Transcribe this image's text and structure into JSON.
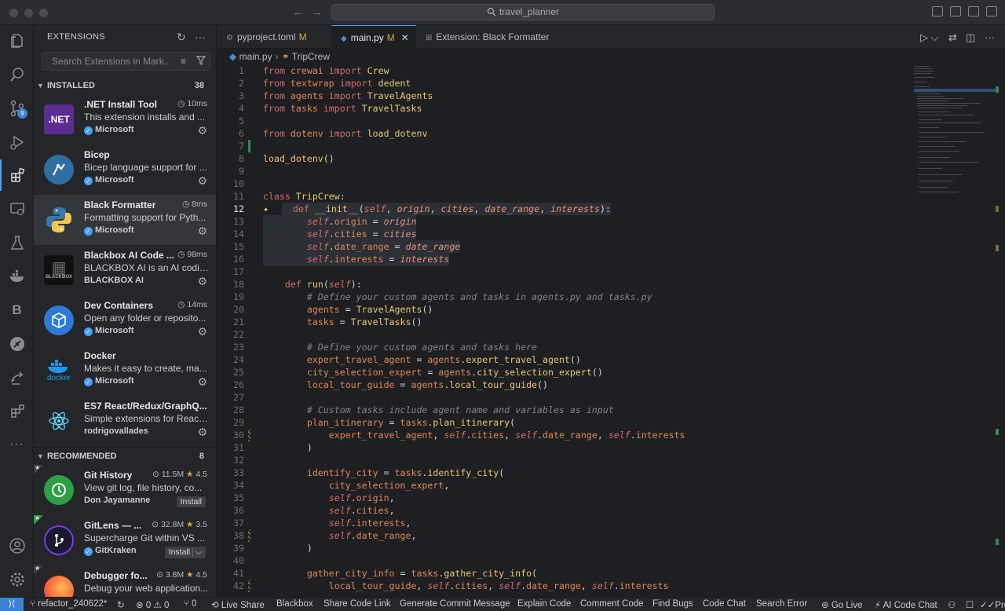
{
  "window": {
    "search_text": "travel_planner",
    "nav_back": "←",
    "nav_forward": "→"
  },
  "activity": {
    "scm_badge": "9",
    "b_label": "B"
  },
  "sidebar": {
    "title": "EXTENSIONS",
    "search_placeholder": "Search Extensions in Mark...",
    "installed_label": "INSTALLED",
    "installed_count": "38",
    "recommended_label": "RECOMMENDED",
    "recommended_count": "8",
    "installed": [
      {
        "name": ".NET Install Tool",
        "meta": "10ms",
        "desc": "This extension installs and ...",
        "publisher": "Microsoft",
        "icon_text": ".NET"
      },
      {
        "name": "Bicep",
        "meta": "",
        "desc": "Bicep language support for ...",
        "publisher": "Microsoft",
        "icon_text": ""
      },
      {
        "name": "Black Formatter",
        "meta": "8ms",
        "desc": "Formatting support for Pyth...",
        "publisher": "Microsoft",
        "icon_text": ""
      },
      {
        "name": "Blackbox AI Code ...",
        "meta": "98ms",
        "desc": "BLACKBOX AI is an AI codin...",
        "publisher": "BLACKBOX AI",
        "icon_text": "BLACKBOX"
      },
      {
        "name": "Dev Containers",
        "meta": "14ms",
        "desc": "Open any folder or reposito...",
        "publisher": "Microsoft",
        "icon_text": ""
      },
      {
        "name": "Docker",
        "meta": "",
        "desc": "Makes it easy to create, ma...",
        "publisher": "Microsoft",
        "icon_text": "docker"
      },
      {
        "name": "ES7 React/Redux/GraphQ...",
        "meta": "",
        "desc": "Simple extensions for React...",
        "publisher": "rodrigovallades",
        "icon_text": ""
      }
    ],
    "recommended": [
      {
        "name": "Git History",
        "downloads": "11.5M",
        "rating": "4.5",
        "desc": "View git log, file history, co...",
        "publisher": "Don Jayamanne",
        "action": "Install"
      },
      {
        "name": "GitLens — ...",
        "downloads": "32.8M",
        "rating": "3.5",
        "desc": "Supercharge Git within VS ...",
        "publisher": "GitKraken",
        "action": "Install"
      },
      {
        "name": "Debugger fo...",
        "downloads": "3.8M",
        "rating": "4.5",
        "desc": "Debug your web application...",
        "publisher": "",
        "action": ""
      }
    ]
  },
  "tabs": [
    {
      "label": "pyproject.toml",
      "flag": "M"
    },
    {
      "label": "main.py",
      "flag": "M",
      "close": "✕"
    },
    {
      "label": "Extension: Black Formatter",
      "flag": ""
    }
  ],
  "breadcrumb": {
    "file": "main.py",
    "symbol": "TripCrew"
  },
  "status": {
    "branch": "refactor_240622*",
    "errors": "0",
    "warnings": "0",
    "ports": "0",
    "items": [
      "Live Share",
      "Blackbox",
      "Share Code Link",
      "Generate Commit Message",
      "Explain Code",
      "Comment Code",
      "Find Bugs",
      "Code Chat",
      "Search Error",
      "Go Live",
      "AI Code Chat",
      "Prettier"
    ]
  }
}
